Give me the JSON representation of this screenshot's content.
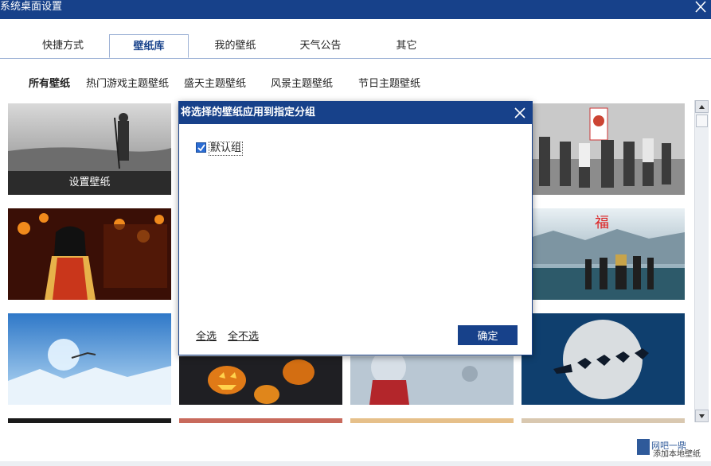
{
  "window": {
    "title": "系统桌面设置"
  },
  "tabs": [
    {
      "label": "快捷方式"
    },
    {
      "label": "壁纸库"
    },
    {
      "label": "我的壁纸"
    },
    {
      "label": "天气公告"
    },
    {
      "label": "其它"
    }
  ],
  "categories": [
    {
      "label": "所有壁纸"
    },
    {
      "label": "热门游戏主题壁纸"
    },
    {
      "label": "盛天主题壁纸"
    },
    {
      "label": "风景主题壁纸"
    },
    {
      "label": "节日主题壁纸"
    }
  ],
  "tiles": {
    "hover_caption": "设置壁纸"
  },
  "dialog": {
    "title": "将选择的壁纸应用到指定分组",
    "groups": [
      {
        "label": "默认组",
        "checked": true
      }
    ],
    "select_all": "全选",
    "select_none": "全不选",
    "ok": "确定"
  },
  "watermark": {
    "line1": "网吧一鼎",
    "line2": "添加本地壁纸"
  }
}
